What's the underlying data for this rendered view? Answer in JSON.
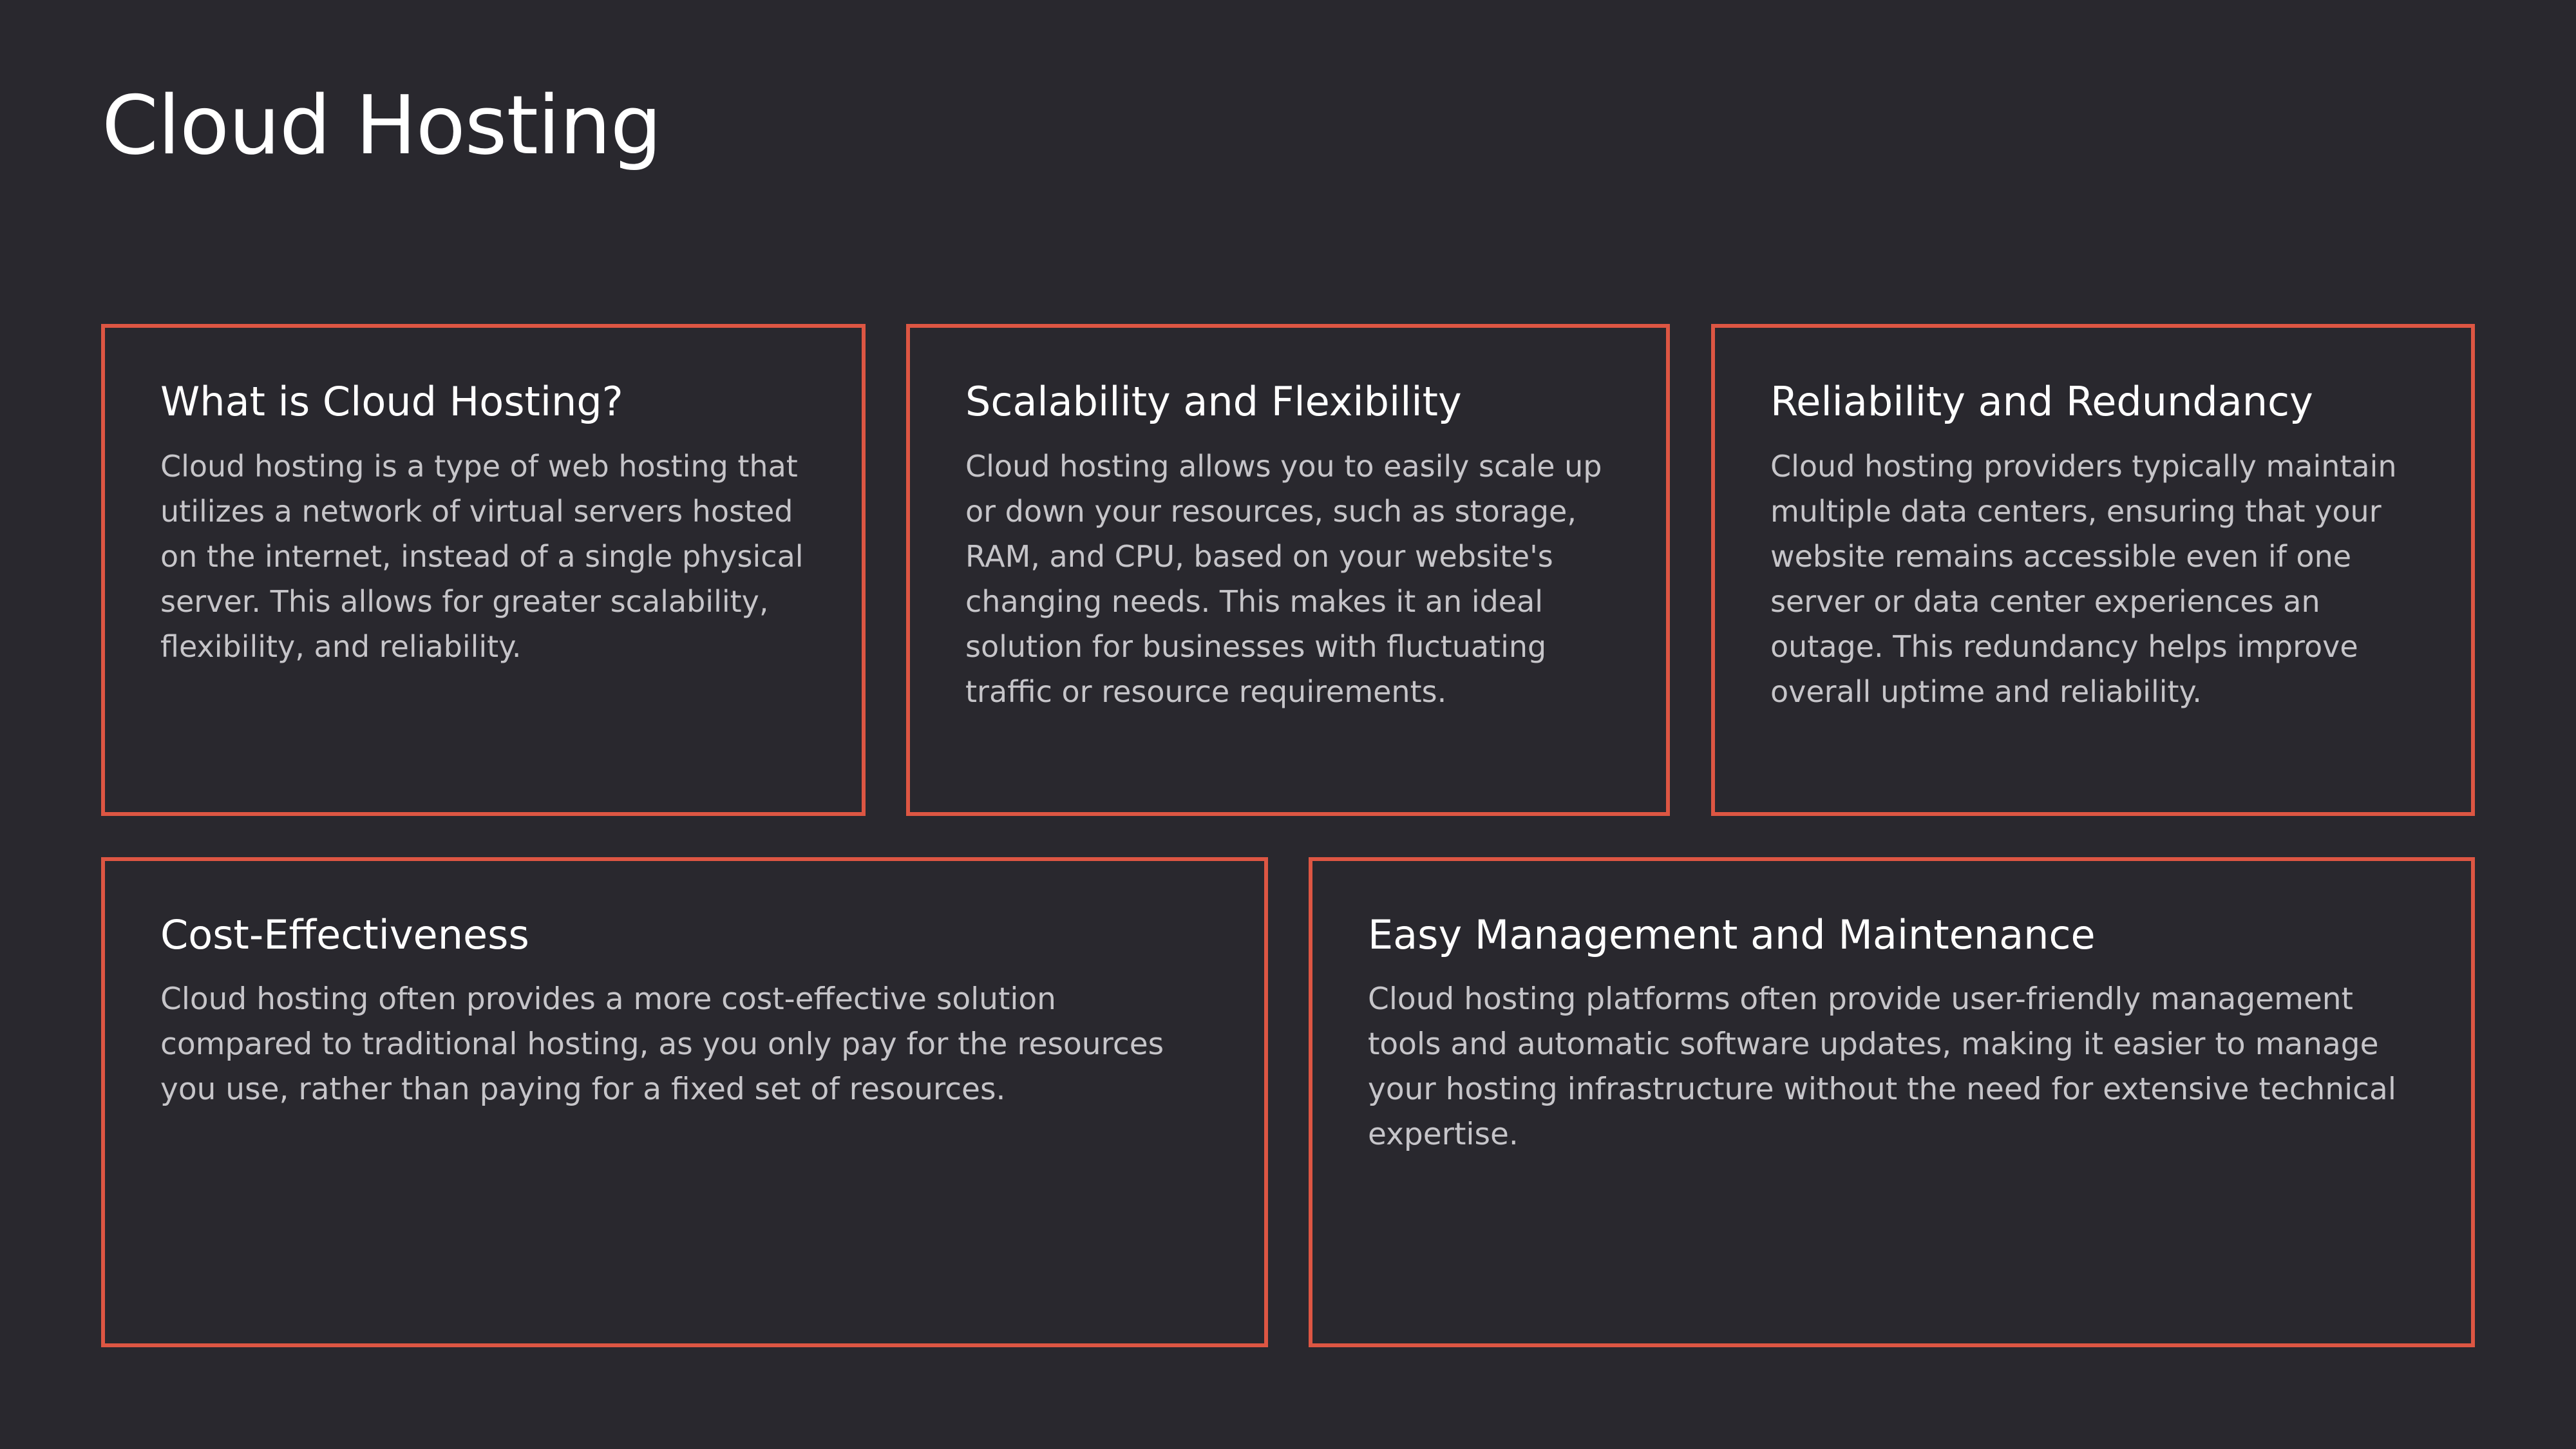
{
  "slide": {
    "title": "Cloud Hosting",
    "accent_color": "#dd5643",
    "background_color": "#29282e"
  },
  "cards": [
    {
      "heading": "What is Cloud Hosting?",
      "body": "Cloud hosting is a type of web hosting that utilizes a network of virtual servers hosted on the internet, instead of a single physical server. This allows for greater scalability, flexibility, and reliability."
    },
    {
      "heading": "Scalability and Flexibility",
      "body": "Cloud hosting allows you to easily scale up or down your resources, such as storage, RAM, and CPU, based on your website's changing needs. This makes it an ideal solution for businesses with fluctuating traffic or resource requirements."
    },
    {
      "heading": "Reliability and Redundancy",
      "body": "Cloud hosting providers typically maintain multiple data centers, ensuring that your website remains accessible even if one server or data center experiences an outage. This redundancy helps improve overall uptime and reliability."
    },
    {
      "heading": "Cost-Effectiveness",
      "body": "Cloud hosting often provides a more cost-effective solution compared to traditional hosting, as you only pay for the resources you use, rather than paying for a fixed set of resources."
    },
    {
      "heading": "Easy Management and Maintenance",
      "body": "Cloud hosting platforms often provide user-friendly management tools and automatic software updates, making it easier to manage your hosting infrastructure without the need for extensive technical expertise."
    }
  ]
}
